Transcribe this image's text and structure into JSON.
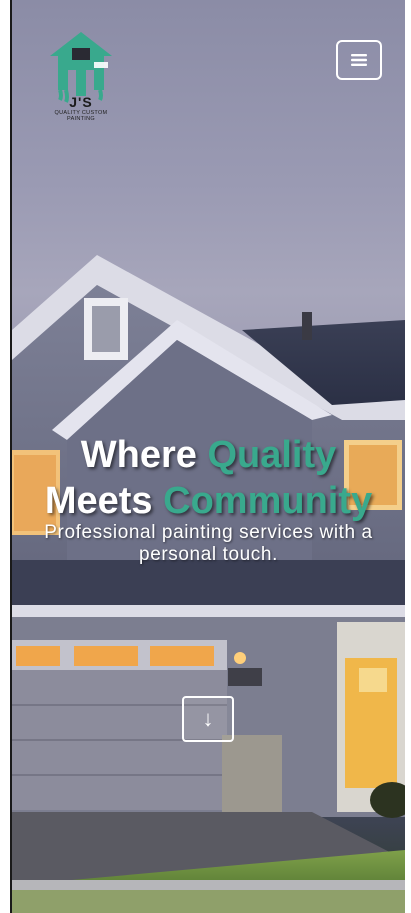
{
  "logo": {
    "title": "J'S",
    "subtitle_line1": "QUALITY CUSTOM",
    "subtitle_line2": "PAINTING",
    "brand_color": "#39a98d"
  },
  "nav": {
    "menu_icon": "hamburger-icon"
  },
  "hero": {
    "title_word1": "Where ",
    "title_word2": "Quality",
    "title_word3": "Meets ",
    "title_word4": "Community",
    "accent_color": "#39a98d",
    "subtitle": "Professional painting services with a personal touch."
  },
  "scroll": {
    "icon": "arrow-down-icon",
    "glyph": "↓"
  }
}
